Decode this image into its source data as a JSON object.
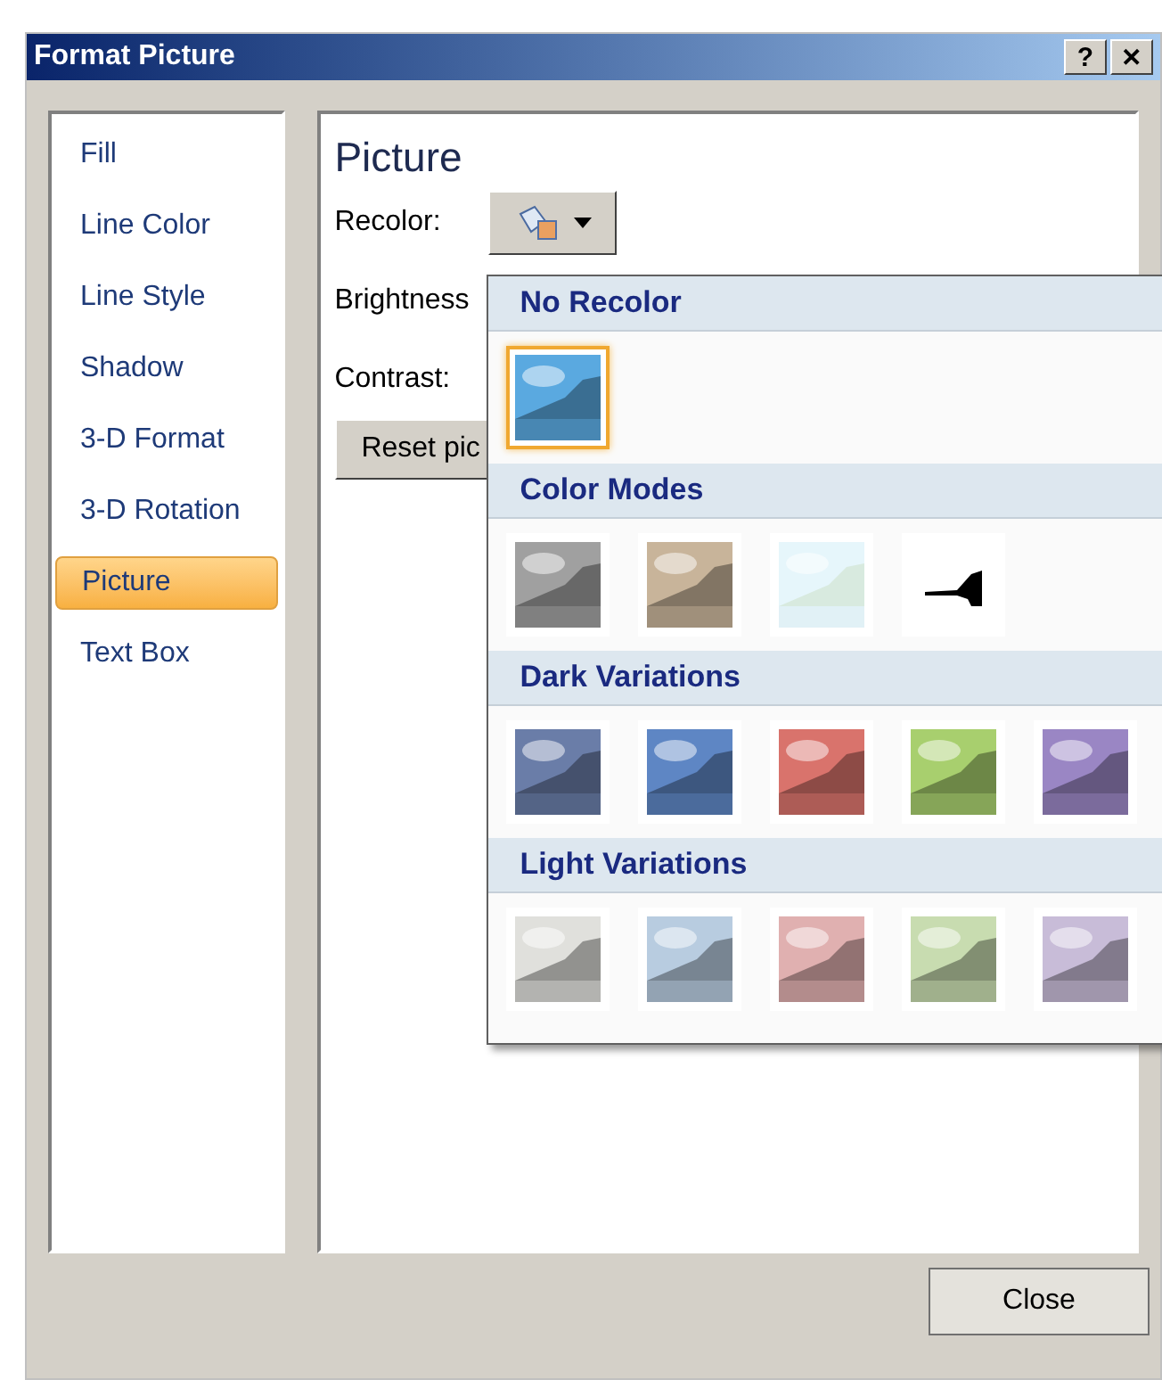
{
  "window": {
    "title": "Format Picture",
    "help_button": "?",
    "close_button": "✕"
  },
  "sidebar": {
    "items": [
      {
        "label": "Fill",
        "selected": false
      },
      {
        "label": "Line Color",
        "selected": false
      },
      {
        "label": "Line Style",
        "selected": false
      },
      {
        "label": "Shadow",
        "selected": false
      },
      {
        "label": "3-D Format",
        "selected": false
      },
      {
        "label": "3-D Rotation",
        "selected": false
      },
      {
        "label": "Picture",
        "selected": true
      },
      {
        "label": "Text Box",
        "selected": false
      }
    ]
  },
  "panel": {
    "title": "Picture",
    "recolor_label": "Recolor:",
    "brightness_label": "Brightness",
    "contrast_label": "Contrast:",
    "reset_button": "Reset pic"
  },
  "recolor_menu": {
    "sections": [
      {
        "title": "No Recolor",
        "swatches": [
          {
            "kind": "picture",
            "color": "#5aa9e0",
            "selected": true
          }
        ]
      },
      {
        "title": "Color Modes",
        "swatches": [
          {
            "kind": "picture",
            "color": "#a0a0a0",
            "selected": false
          },
          {
            "kind": "picture",
            "color": "#c8b49a",
            "selected": false
          },
          {
            "kind": "washout",
            "color": "#e6f6fb",
            "selected": false
          },
          {
            "kind": "silhouette",
            "color": "#000000",
            "selected": false
          }
        ]
      },
      {
        "title": "Dark Variations",
        "swatches": [
          {
            "kind": "picture",
            "color": "#6a7da8",
            "selected": false
          },
          {
            "kind": "picture",
            "color": "#5e86c4",
            "selected": false
          },
          {
            "kind": "picture",
            "color": "#d9736c",
            "selected": false
          },
          {
            "kind": "picture",
            "color": "#a8cf6e",
            "selected": false
          },
          {
            "kind": "picture",
            "color": "#9a86c4",
            "selected": false
          }
        ]
      },
      {
        "title": "Light Variations",
        "swatches": [
          {
            "kind": "picture",
            "color": "#e0e0dc",
            "selected": false
          },
          {
            "kind": "picture",
            "color": "#b8cce0",
            "selected": false
          },
          {
            "kind": "picture",
            "color": "#e0b0b0",
            "selected": false
          },
          {
            "kind": "picture",
            "color": "#c8dcb0",
            "selected": false
          },
          {
            "kind": "picture",
            "color": "#c8bcd8",
            "selected": false
          }
        ]
      }
    ]
  },
  "footer": {
    "close_button": "Close"
  }
}
